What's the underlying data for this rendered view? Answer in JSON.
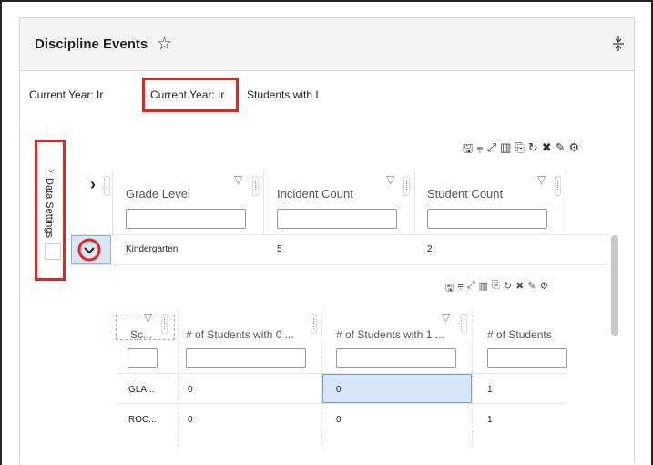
{
  "panel": {
    "title": "Discipline Events",
    "star_icon": "star-outline-icon",
    "collapse_icon": "collapse-vertical-icon"
  },
  "tabs": [
    {
      "label": "Current Year: Ir"
    },
    {
      "label": "Current Year: Ir"
    },
    {
      "label": "Students with I"
    }
  ],
  "side_panel": {
    "label": "Data Settings",
    "chevron": "›"
  },
  "toolbar": {
    "icons": [
      "save-icon",
      "filter-clear-icon",
      "expand-icon",
      "columns-icon",
      "export-icon",
      "refresh-icon",
      "tools-icon",
      "magic-icon",
      "settings-icon"
    ],
    "glyphs": [
      "🖫",
      "⩦",
      "⤢",
      "▥",
      "⎘",
      "↻",
      "✖",
      "✎",
      "⚙"
    ]
  },
  "main_grid": {
    "expand_all": "›",
    "columns": [
      "Grade Level",
      "Incident Count",
      "Student Count"
    ],
    "rows": [
      {
        "grade": "Kindergarten",
        "incidents": "5",
        "students": "2"
      }
    ]
  },
  "sub_grid": {
    "columns": [
      "Sc...",
      "# of Students with 0 ...",
      "# of Students with 1 ...",
      "# of Students"
    ],
    "rows": [
      [
        "GLA...",
        "0",
        "0",
        "1"
      ],
      [
        "ROC...",
        "0",
        "0",
        "1"
      ]
    ]
  },
  "colors": {
    "highlight": "#e8231a",
    "selected_cell": "#d6e6f6"
  }
}
